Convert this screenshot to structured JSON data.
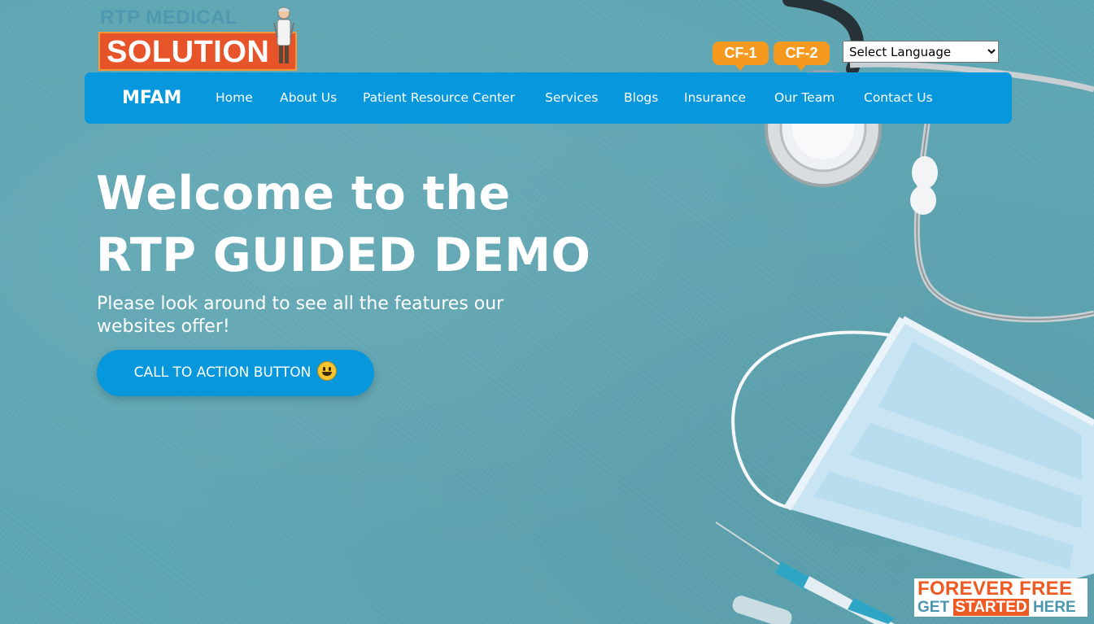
{
  "logo": {
    "top_text": "RTP MEDICAL",
    "main_text": "SOLUTION"
  },
  "badges": {
    "cf1": "CF-1",
    "cf2": "CF-2"
  },
  "language_select": {
    "selected": "Select Language"
  },
  "nav": {
    "brand": "MFAM",
    "items": [
      "Home",
      "About Us",
      "Patient Resource Center",
      "Services",
      "Blogs",
      "Insurance",
      "Our Team",
      "Contact Us"
    ]
  },
  "hero": {
    "title_line1": "Welcome to the",
    "title_line2": "RTP GUIDED DEMO",
    "subtitle": "Please look around to see all the features our websites offer!",
    "cta_label": "CALL TO ACTION BUTTON"
  },
  "forever_badge": {
    "line1": "FOREVER FREE",
    "get": "GET",
    "started": "STARTED",
    "here": "HERE"
  },
  "colors": {
    "background": "#5fa6b3",
    "nav_blue": "#0797dc",
    "orange": "#f59a1f",
    "logo_red": "#e8542a"
  },
  "icons": {
    "cta_emoji": "grinning-face-icon",
    "logo_figure": "doctor-figure-icon"
  }
}
